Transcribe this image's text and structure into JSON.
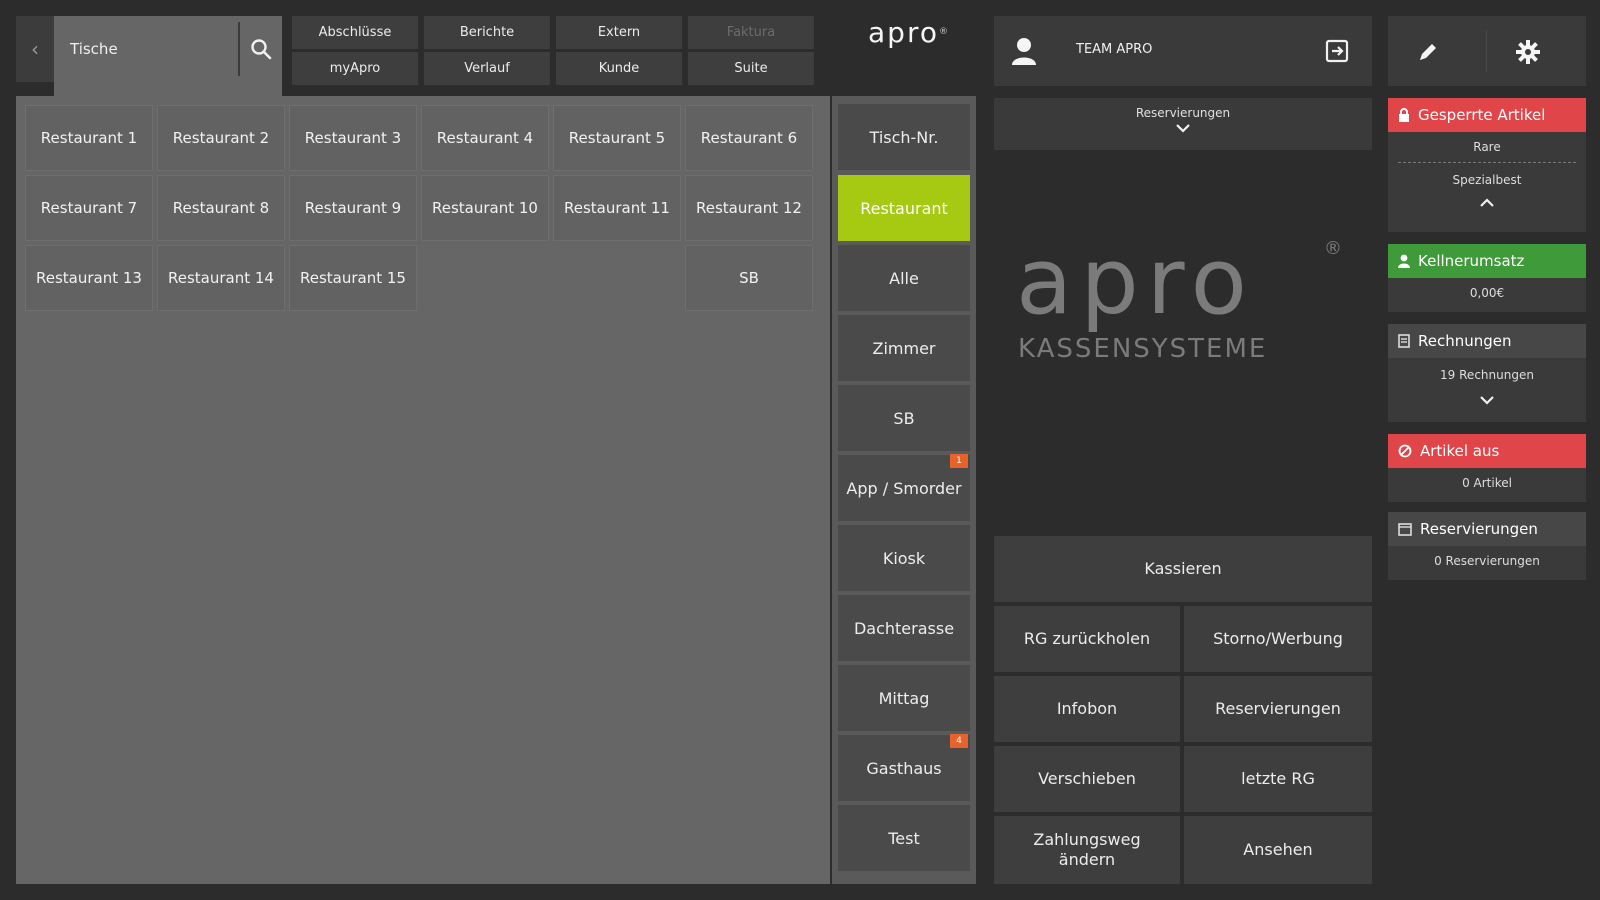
{
  "search": {
    "label": "Tische"
  },
  "top_tabs": {
    "row1": [
      "Abschlüsse",
      "Berichte",
      "Extern",
      "Faktura"
    ],
    "row2": [
      "myApro",
      "Verlauf",
      "Kunde",
      "Suite"
    ]
  },
  "logo_small": "apro",
  "tables": [
    [
      "Restaurant 1",
      "Restaurant 2",
      "Restaurant 3",
      "Restaurant 4",
      "Restaurant 5",
      "Restaurant 6"
    ],
    [
      "Restaurant 7",
      "Restaurant 8",
      "Restaurant 9",
      "Restaurant 10",
      "Restaurant 11",
      "Restaurant 12"
    ],
    [
      "Restaurant 13",
      "Restaurant 14",
      "Restaurant 15",
      "SB"
    ]
  ],
  "categories": [
    "Tisch-Nr.",
    "Restaurant",
    "Alle",
    "Zimmer",
    "SB",
    "App / Smorder",
    "Kiosk",
    "Dachterasse",
    "Mittag",
    "Gasthaus",
    "Test"
  ],
  "category_badges": {
    "app": "1",
    "gasthaus": "4"
  },
  "user": {
    "name": "TEAM APRO"
  },
  "reservations_bar": {
    "label": "Reservierungen"
  },
  "brand": {
    "name": "apro",
    "registered": "®",
    "subtitle": "KASSENSYSTEME"
  },
  "actions": {
    "checkout": "Kassieren",
    "retrieve": "RG zurückholen",
    "storno": "Storno/Werbung",
    "infobon": "Infobon",
    "reservations": "Reservierungen",
    "move": "Verschieben",
    "last_invoice": "letzte RG",
    "payment_line1": "Zahlungsweg",
    "payment_line2": "ändern",
    "view": "Ansehen"
  },
  "cards": {
    "blocked": {
      "title": "Gesperrte Artikel",
      "line1": "Rare",
      "line2": "Spezialbest"
    },
    "waiter": {
      "title": "Kellnerumsatz",
      "value": "0,00€"
    },
    "invoices": {
      "title": "Rechnungen",
      "value": "19 Rechnungen"
    },
    "out": {
      "title": "Artikel aus",
      "value": "0 Artikel"
    },
    "reservations": {
      "title": "Reservierungen",
      "value": "0 Reservierungen"
    }
  },
  "colors": {
    "accent_green": "#a6c912",
    "alert_red": "#e0454a",
    "ok_green": "#3f9a3a",
    "badge_orange": "#e8622a"
  }
}
